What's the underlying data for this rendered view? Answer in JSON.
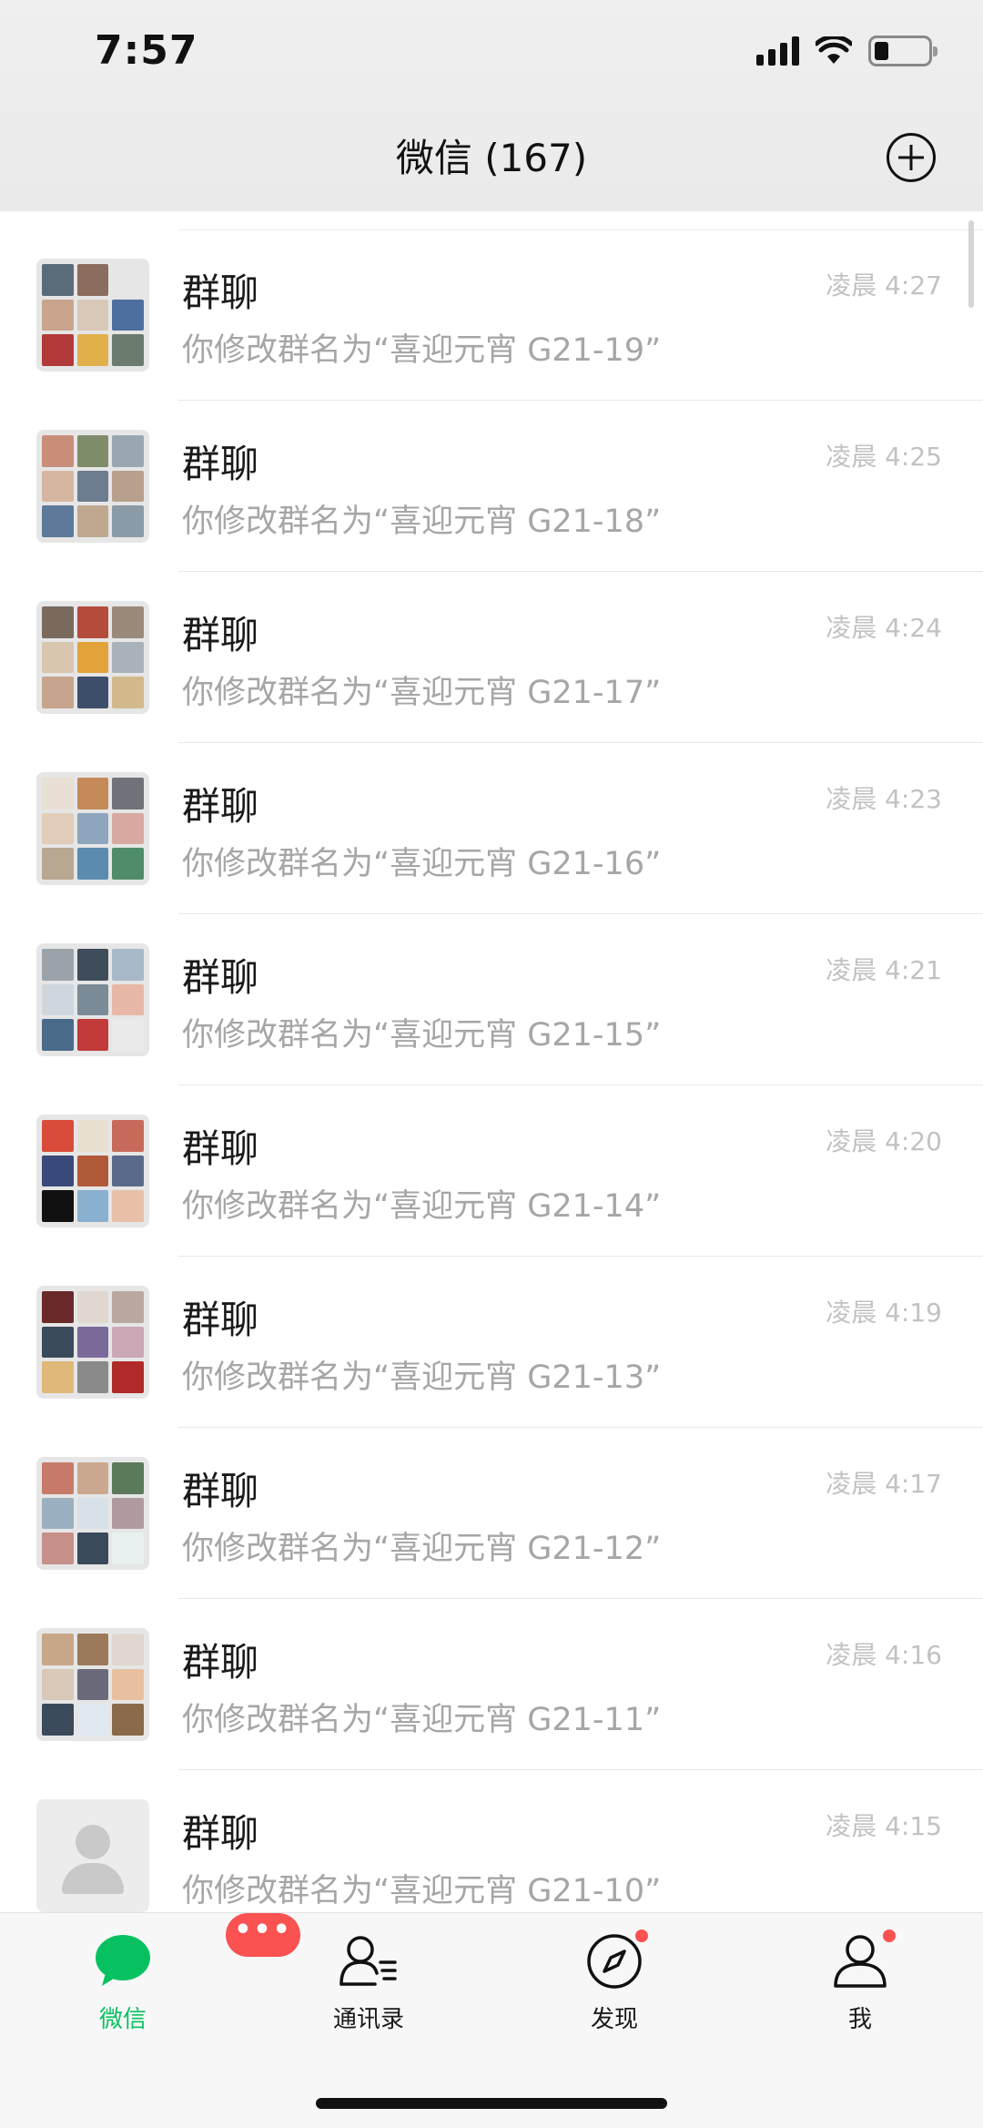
{
  "status_bar": {
    "time": "7:57"
  },
  "header": {
    "title": "微信 (167)"
  },
  "chats": [
    {
      "name": "群聊",
      "message": "你修改群名为“喜迎元宵 G21-19”",
      "time": "凌晨 4:27",
      "avatar": "group-grid"
    },
    {
      "name": "群聊",
      "message": "你修改群名为“喜迎元宵 G21-18”",
      "time": "凌晨 4:25",
      "avatar": "group-grid"
    },
    {
      "name": "群聊",
      "message": "你修改群名为“喜迎元宵 G21-17”",
      "time": "凌晨 4:24",
      "avatar": "group-grid"
    },
    {
      "name": "群聊",
      "message": "你修改群名为“喜迎元宵 G21-16”",
      "time": "凌晨 4:23",
      "avatar": "group-grid"
    },
    {
      "name": "群聊",
      "message": "你修改群名为“喜迎元宵 G21-15”",
      "time": "凌晨 4:21",
      "avatar": "group-grid"
    },
    {
      "name": "群聊",
      "message": "你修改群名为“喜迎元宵 G21-14”",
      "time": "凌晨 4:20",
      "avatar": "group-grid"
    },
    {
      "name": "群聊",
      "message": "你修改群名为“喜迎元宵 G21-13”",
      "time": "凌晨 4:19",
      "avatar": "group-grid"
    },
    {
      "name": "群聊",
      "message": "你修改群名为“喜迎元宵 G21-12”",
      "time": "凌晨 4:17",
      "avatar": "group-grid"
    },
    {
      "name": "群聊",
      "message": "你修改群名为“喜迎元宵 G21-11”",
      "time": "凌晨 4:16",
      "avatar": "group-grid"
    },
    {
      "name": "群聊",
      "message": "你修改群名为“喜迎元宵 G21-10”",
      "time": "凌晨 4:15",
      "avatar": "default-person"
    }
  ],
  "tabs": [
    {
      "label": "微信",
      "icon": "chat-bubble-icon",
      "active": true,
      "badge": "•••"
    },
    {
      "label": "通讯录",
      "icon": "contacts-icon"
    },
    {
      "label": "发现",
      "icon": "compass-icon",
      "dot": true
    },
    {
      "label": "我",
      "icon": "person-icon",
      "dot": true
    }
  ],
  "colors": {
    "accent_green": "#07c160",
    "badge_red": "#fa5151",
    "header_bg": "#ededed",
    "tabbar_bg": "#f7f7f7"
  }
}
